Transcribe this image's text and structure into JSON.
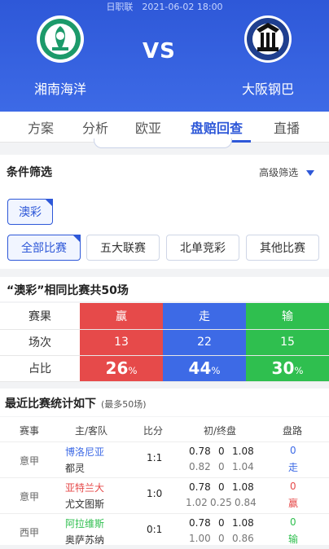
{
  "match": {
    "info": "日职联　2021-06-02 18:00",
    "vs": "VS",
    "home": {
      "name": "湘南海洋",
      "logo_icon": "bellmare-crest-icon",
      "color": "#1c9a6a"
    },
    "away": {
      "name": "大阪钢巴",
      "logo_icon": "gamba-crest-icon",
      "color": "#1f3f8f"
    }
  },
  "tabs": [
    {
      "label": "方案"
    },
    {
      "label": "分析"
    },
    {
      "label": "欧亚"
    },
    {
      "label": "盘赔回查",
      "active": true
    },
    {
      "label": "直播"
    }
  ],
  "filters": {
    "title": "条件筛选",
    "advanced": "高级筛选",
    "company": "澳彩",
    "scopes": [
      {
        "label": "全部比赛",
        "selected": true
      },
      {
        "label": "五大联赛"
      },
      {
        "label": "北单竞彩"
      },
      {
        "label": "其他比赛"
      }
    ]
  },
  "summary": {
    "title": "“澳彩”相同比赛共50场",
    "row_labels": [
      "赛果",
      "场次",
      "占比"
    ],
    "results": [
      "赢",
      "走",
      "输"
    ],
    "counts": [
      "13",
      "22",
      "15"
    ],
    "pct": [
      "26",
      "44",
      "30"
    ],
    "pct_unit": "%",
    "colors": {
      "win": "#e64a4a",
      "draw": "#3d6ae6",
      "loss": "#2fbf4f"
    }
  },
  "recent": {
    "title": "最近比赛统计如下",
    "note": "(最多50场)",
    "headers": [
      "赛事",
      "主/客队",
      "比分",
      "初/终盘",
      "盘路"
    ],
    "rows": [
      {
        "league": "意甲",
        "home": "博洛尼亚",
        "away": "都灵",
        "score": "1:1",
        "init": [
          "0.78",
          "0",
          "1.08"
        ],
        "final": [
          "0.82",
          "0",
          "1.04"
        ],
        "handicap_value": "0",
        "result": "走",
        "home_color": "#3d6ae6",
        "result_color": "#3d6ae6"
      },
      {
        "league": "意甲",
        "home": "亚特兰大",
        "away": "尤文图斯",
        "score": "1:0",
        "init": [
          "0.78",
          "0",
          "1.08"
        ],
        "final": [
          "1.02",
          "0.25",
          "0.84"
        ],
        "handicap_value": "0",
        "result": "赢",
        "home_color": "#e64a4a",
        "result_color": "#e64a4a"
      },
      {
        "league": "西甲",
        "home": "阿拉维斯",
        "away": "奥萨苏纳",
        "score": "0:1",
        "init": [
          "0.78",
          "0",
          "1.08"
        ],
        "final": [
          "1.00",
          "0",
          "0.86"
        ],
        "handicap_value": "0",
        "result": "输",
        "home_color": "#2fbf4f",
        "result_color": "#2fbf4f"
      }
    ]
  }
}
